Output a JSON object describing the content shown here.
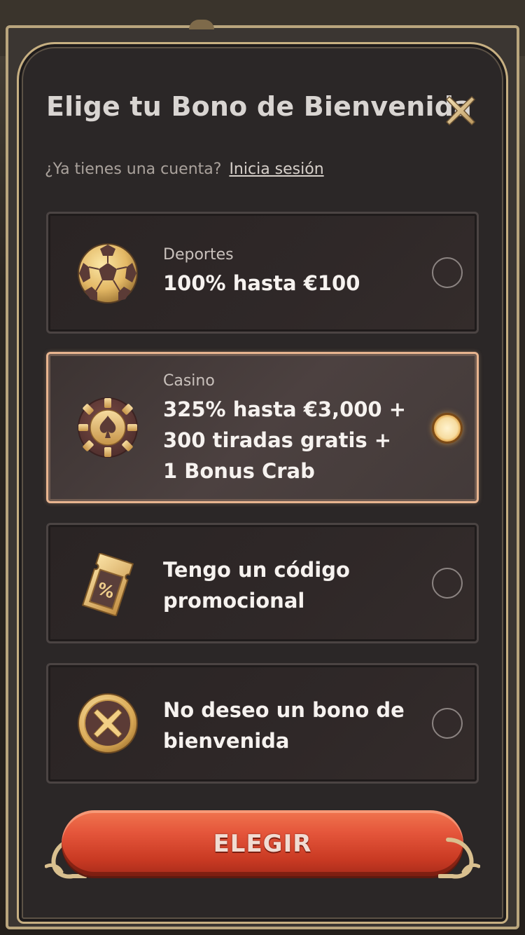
{
  "modal": {
    "title": "Elige tu Bono de Bienvenida",
    "account_prompt": "¿Ya tienes una cuenta?",
    "login_link": "Inicia sesión"
  },
  "options": [
    {
      "id": "deportes",
      "label": "Deportes",
      "title_lines": [
        "100% hasta €100"
      ],
      "icon": "soccer-ball-icon",
      "selected": false
    },
    {
      "id": "casino",
      "label": "Casino",
      "title_lines": [
        "325% hasta €3,000 +",
        "300 tiradas gratis +",
        "1 Bonus Crab"
      ],
      "icon": "poker-chip-spade-icon",
      "selected": true
    },
    {
      "id": "promo",
      "label": "",
      "title_lines": [
        "Tengo un código",
        "promocional"
      ],
      "icon": "promo-ticket-percent-icon",
      "selected": false
    },
    {
      "id": "none",
      "label": "",
      "title_lines": [
        "No deseo un bono de",
        "bienvenida"
      ],
      "icon": "x-coin-icon",
      "selected": false
    }
  ],
  "cta": {
    "label": "ELEGIR"
  },
  "colors": {
    "accent_gold": "#c7b082",
    "selected_border": "#e7b48f",
    "button_red": "#e4553a",
    "panel_bg": "#2b2727"
  }
}
